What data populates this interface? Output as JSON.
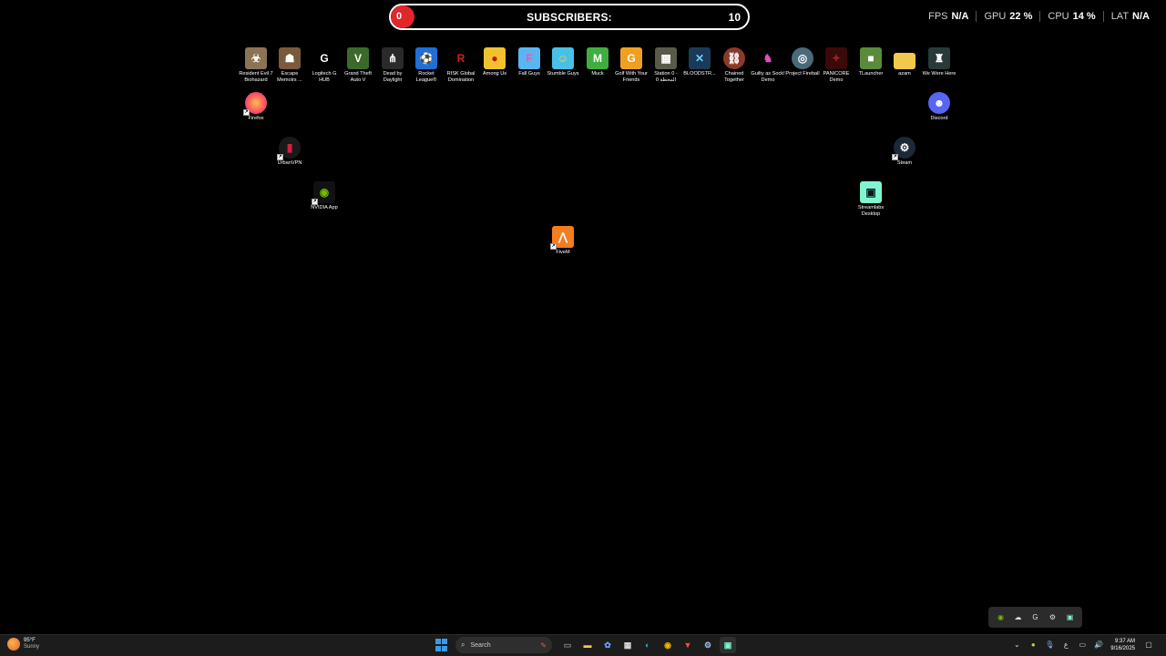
{
  "subscriber_bar": {
    "current": "0",
    "label": "SUBSCRIBERS:",
    "goal": "10",
    "progress_percent": 0
  },
  "stats": [
    {
      "name": "FPS",
      "value": "N/A"
    },
    {
      "name": "GPU",
      "value": "22 %"
    },
    {
      "name": "CPU",
      "value": "14 %"
    },
    {
      "name": "LAT",
      "value": "N/A"
    }
  ],
  "desktop_icons": {
    "resident_evil": "Resident Evil 7 Biohazard",
    "escape_memoirs": "Escape Memoirs ...",
    "logitech": "Logitech G HUB",
    "gta": "Grand Theft Auto V",
    "dbd": "Dead by Daylight",
    "rocket_league": "Rocket League®",
    "risk": "RISK Global Domination",
    "among_us": "Among Us",
    "fall_guys": "Fall Guys",
    "stumble_guys": "Stumble Guys",
    "muck": "Muck",
    "golf": "Golf With Your Friends",
    "station": "Station 0 - المحطة 0",
    "bloodstrike": "BLOODSTR...",
    "chained": "Chained Together",
    "guilty_sock": "Guilty as Sock! Demo",
    "project_fireball": "Project Fireball",
    "panicore": "PANICORE Demo",
    "tlauncher": "TLauncher",
    "azam": "azam",
    "we_were_here": "We Were Here",
    "firefox": "Firefox",
    "discord": "Discord",
    "urbanvpn": "UrbanVPN",
    "steam": "Steam",
    "nvidia": "NVIDIA App",
    "streamlabs": "Streamlabs Desktop",
    "fivem": "FiveM"
  },
  "taskbar": {
    "weather_temp": "95°F",
    "weather_desc": "Sunny",
    "search_placeholder": "Search",
    "lang": "ع",
    "time": "9:37 AM",
    "date": "9/16/2025"
  },
  "colors": {
    "subscriber_fill": "#e3262b",
    "taskbar_bg": "#1c1c1c",
    "start_blue": "#3b9ae8"
  }
}
